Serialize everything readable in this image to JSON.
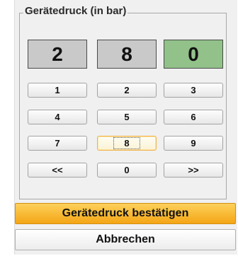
{
  "dialog": {
    "group_title": "Gerätedruck (in bar)",
    "digits": [
      "2",
      "8",
      "0"
    ],
    "active_digit_index": 2,
    "keypad": [
      [
        "1",
        "2",
        "3"
      ],
      [
        "4",
        "5",
        "6"
      ],
      [
        "7",
        "8",
        "9"
      ],
      [
        "<<",
        "0",
        ">>"
      ]
    ],
    "focused_key": "8",
    "confirm_label": "Gerätedruck bestätigen",
    "cancel_label": "Abbrechen"
  },
  "colors": {
    "active_digit": "#92c18a",
    "digit_bg": "#c9c9c9",
    "confirm_bg": "#f4a516"
  }
}
